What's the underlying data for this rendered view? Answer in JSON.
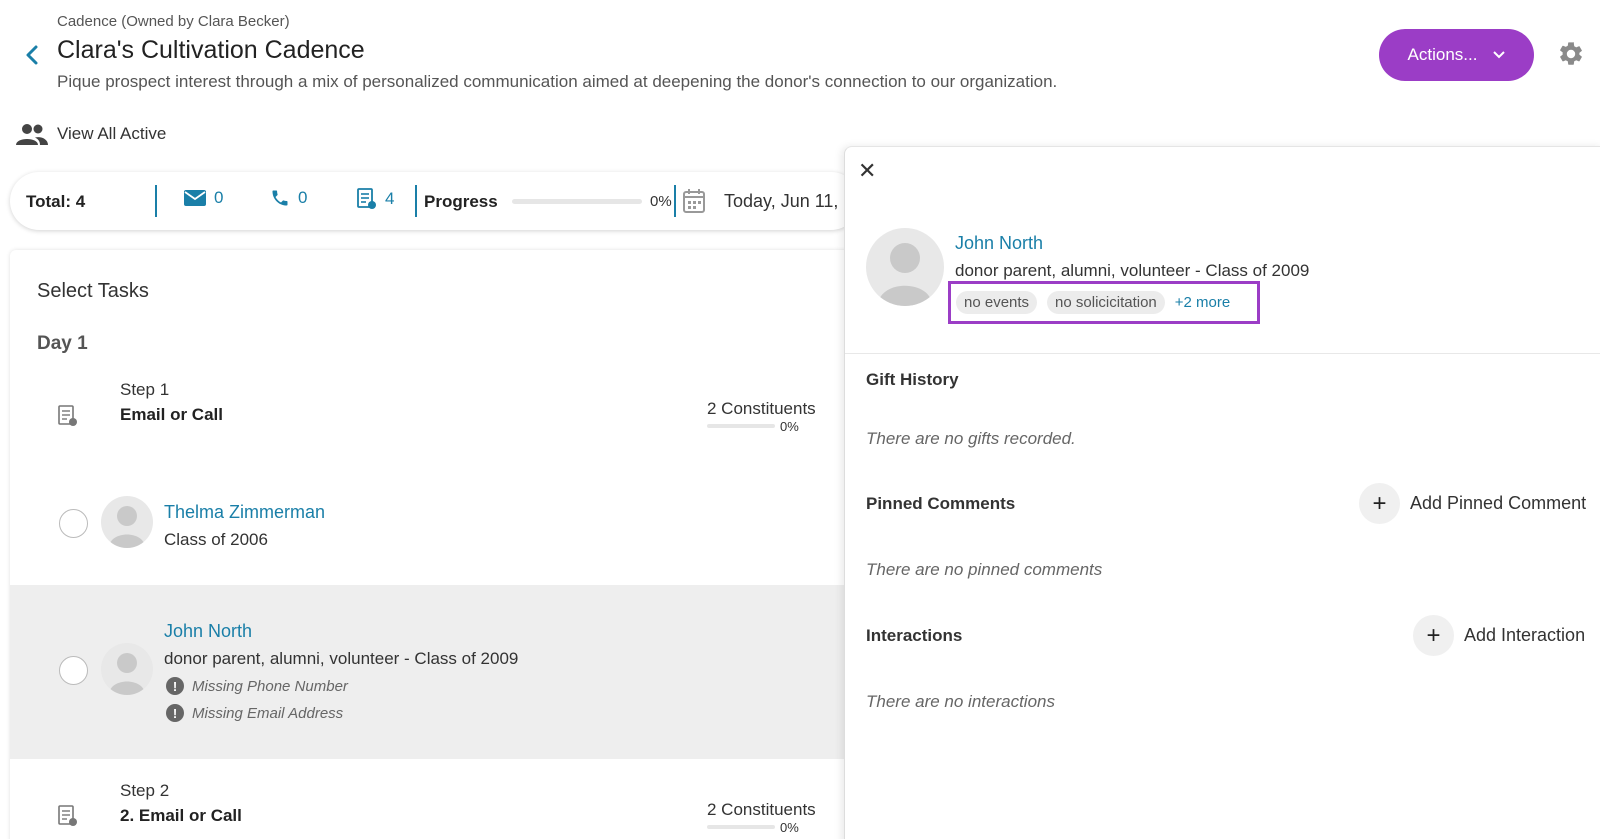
{
  "header": {
    "owner": "Cadence (Owned by Clara Becker)",
    "title": "Clara's Cultivation Cadence",
    "description": "Pique prospect interest through a mix of personalized communication aimed at deepening the donor's connection to our organization.",
    "actions_label": "Actions...",
    "view_all_label": "View All Active"
  },
  "stats": {
    "total_label": "Total: 4",
    "email_count": "0",
    "phone_count": "0",
    "task_count": "4",
    "progress_label": "Progress",
    "progress_value": 0,
    "progress_pct": "0%",
    "date": "Today, Jun 11,"
  },
  "tasks": {
    "heading": "Select Tasks",
    "day_label": "Day 1",
    "steps": [
      {
        "num": "Step 1",
        "name": "Email or Call",
        "constituents": "2 Constituents",
        "pct": "0%"
      },
      {
        "num": "Step 2",
        "name": "2. Email or Call",
        "constituents": "2 Constituents",
        "pct": "0%"
      }
    ],
    "people": [
      {
        "name": "Thelma Zimmerman",
        "sub": "Class of 2006"
      },
      {
        "name": "John North",
        "sub": "donor parent, alumni, volunteer - Class of 2009",
        "warnings": [
          "Missing Phone Number",
          "Missing Email Address"
        ]
      }
    ]
  },
  "drawer": {
    "name": "John North",
    "sub": "donor parent, alumni, volunteer - Class of 2009",
    "tags": [
      "no events",
      "no solicicitation"
    ],
    "more": "+2 more",
    "gift_title": "Gift History",
    "gift_empty": "There are no gifts recorded.",
    "pinned_title": "Pinned Comments",
    "pinned_add": "Add Pinned Comment",
    "pinned_empty": "There are no pinned comments",
    "interactions_title": "Interactions",
    "interactions_add": "Add Interaction",
    "interactions_empty": "There are no interactions"
  },
  "colors": {
    "accent": "#9b3dc6",
    "link": "#1a7fa8"
  }
}
